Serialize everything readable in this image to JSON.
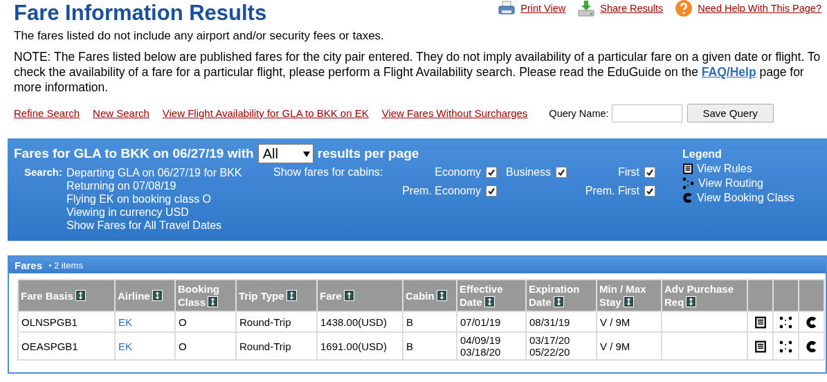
{
  "title": "Fare Information Results",
  "header_links": [
    {
      "kind": "print",
      "label": "Print View"
    },
    {
      "kind": "share",
      "label": "Share Results"
    },
    {
      "kind": "help",
      "label": "Need Help With This Page?"
    }
  ],
  "disclaimer": "The fares listed do not include any airport and/or security fees or taxes.",
  "note": {
    "before": "NOTE: The Fares listed below are published fares for the city pair entered. They do not imply availability of a particular fare on a given date or flight. To check the availability of a fare for a particular flight, please perform a Flight Availability search. Please read the EduGuide on the",
    "link": "FAQ/Help",
    "after": "page for more information."
  },
  "action_links": [
    "Refine Search",
    "New Search",
    "View Flight Availability for GLA to BKK on EK",
    "View Fares Without Surcharges"
  ],
  "query": {
    "label": "Query Name:",
    "button": "Save Query"
  },
  "search_panel": {
    "title_before": "Fares for GLA to BKK on 06/27/19 with",
    "per_page": "All",
    "title_after": "results per page",
    "search_label": "Search:",
    "search_lines": [
      "Departing GLA on 06/27/19 for BKK",
      "Returning on 07/08/19",
      "Flying EK on booking class O",
      "Viewing in currency USD",
      "Show Fares for All Travel Dates"
    ],
    "cabins_label": "Show fares for cabins:",
    "cabins": [
      {
        "label": "Economy",
        "checked": true
      },
      {
        "label": "Business",
        "checked": true
      },
      {
        "label": "First",
        "checked": true
      },
      {
        "label": "Prem. Economy",
        "checked": true
      },
      {
        "label": "Prem. First",
        "checked": true
      }
    ],
    "legend_title": "Legend",
    "legend": [
      {
        "kind": "rules",
        "label": "View Rules"
      },
      {
        "kind": "routing",
        "label": "View Routing"
      },
      {
        "kind": "booking",
        "label": "View Booking Class"
      }
    ]
  },
  "fares": {
    "title": "Fares",
    "count": "2 items",
    "columns": [
      {
        "label": "Fare Basis",
        "sorted": false
      },
      {
        "label": "Airline",
        "sorted": false
      },
      {
        "label": "Booking Class",
        "sorted": false
      },
      {
        "label": "Trip Type",
        "sorted": false
      },
      {
        "label": "Fare",
        "sorted": true
      },
      {
        "label": "Cabin",
        "sorted": false
      },
      {
        "label": "Effective Date",
        "sorted": false
      },
      {
        "label": "Expiration Date",
        "sorted": false
      },
      {
        "label": "Min / Max Stay",
        "sorted": false
      },
      {
        "label": "Adv Purchase Req",
        "sorted": false
      }
    ],
    "rows": [
      {
        "fare_basis": "OLNSPGB1",
        "airline": "EK",
        "booking_class": "O",
        "trip_type": "Round-Trip",
        "fare": "1438.00(USD)",
        "cabin": "B",
        "effective": [
          "07/01/19"
        ],
        "expiration": [
          "08/31/19"
        ],
        "stay": "V / 9M",
        "adv_purchase": ""
      },
      {
        "fare_basis": "OEASPGB1",
        "airline": "EK",
        "booking_class": "O",
        "trip_type": "Round-Trip",
        "fare": "1691.00(USD)",
        "cabin": "B",
        "effective": [
          "04/09/19",
          "03/18/20"
        ],
        "expiration": [
          "03/17/20",
          "05/22/20"
        ],
        "stay": "V / 9M",
        "adv_purchase": ""
      }
    ]
  }
}
